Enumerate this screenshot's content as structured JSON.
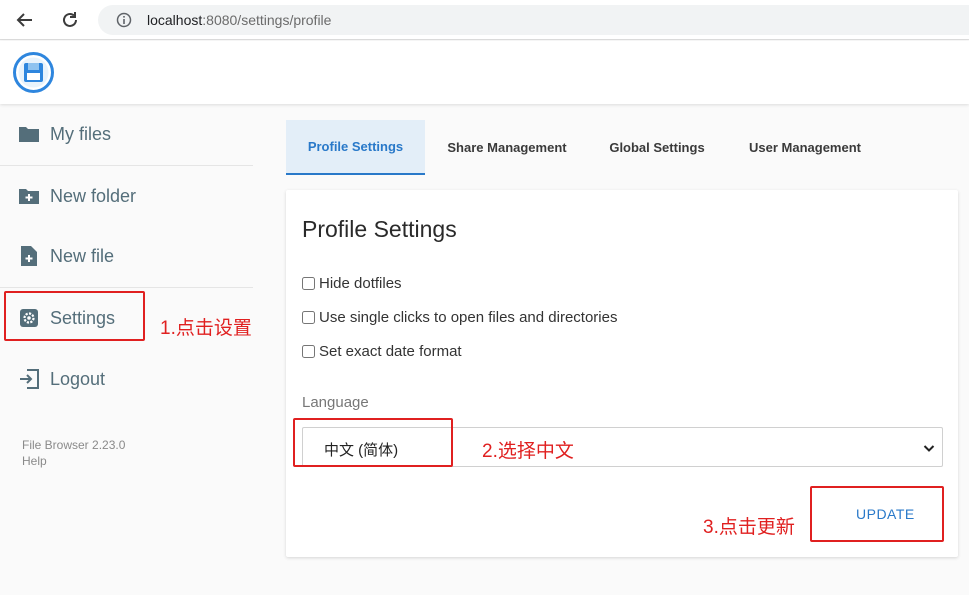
{
  "browser": {
    "url_host": "localhost",
    "url_rest": ":8080/settings/profile"
  },
  "sidebar": {
    "items": [
      {
        "label": "My files",
        "icon": "folder-icon"
      },
      {
        "label": "New folder",
        "icon": "new-folder-icon"
      },
      {
        "label": "New file",
        "icon": "new-file-icon"
      },
      {
        "label": "Settings",
        "icon": "settings-icon"
      },
      {
        "label": "Logout",
        "icon": "logout-icon"
      }
    ],
    "version": "File Browser 2.23.0",
    "help": "Help"
  },
  "tabs": [
    {
      "label": "Profile Settings",
      "active": true
    },
    {
      "label": "Share Management",
      "active": false
    },
    {
      "label": "Global Settings",
      "active": false
    },
    {
      "label": "User Management",
      "active": false
    }
  ],
  "profile": {
    "title": "Profile Settings",
    "checkboxes": [
      {
        "label": "Hide dotfiles",
        "checked": false
      },
      {
        "label": "Use single clicks to open files and directories",
        "checked": false
      },
      {
        "label": "Set exact date format",
        "checked": false
      }
    ],
    "language_label": "Language",
    "language_value": "中文 (简体)",
    "update_label": "UPDATE"
  },
  "annotations": {
    "step1": "1.点击设置",
    "step2": "2.选择中文",
    "step3": "3.点击更新"
  },
  "colors": {
    "accent": "#2979c9",
    "annotation": "#e02020",
    "sidebar_text": "#546e7a"
  }
}
